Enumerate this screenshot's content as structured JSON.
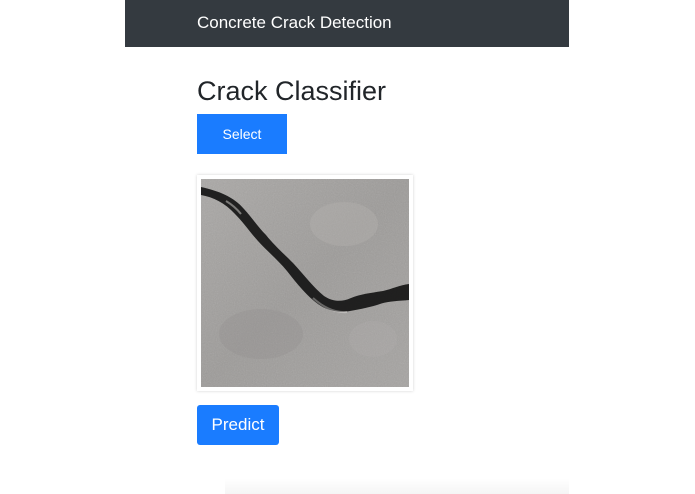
{
  "navbar": {
    "brand": "Concrete Crack Detection"
  },
  "main": {
    "title": "Crack Classifier",
    "select_label": "Select",
    "predict_label": "Predict"
  },
  "colors": {
    "navbar_bg": "#343a40",
    "button_primary": "#1a7cff",
    "concrete": "#9f9f9f",
    "crack": "#1a1a1a"
  },
  "icons": {
    "preview": "concrete-crack-image"
  }
}
